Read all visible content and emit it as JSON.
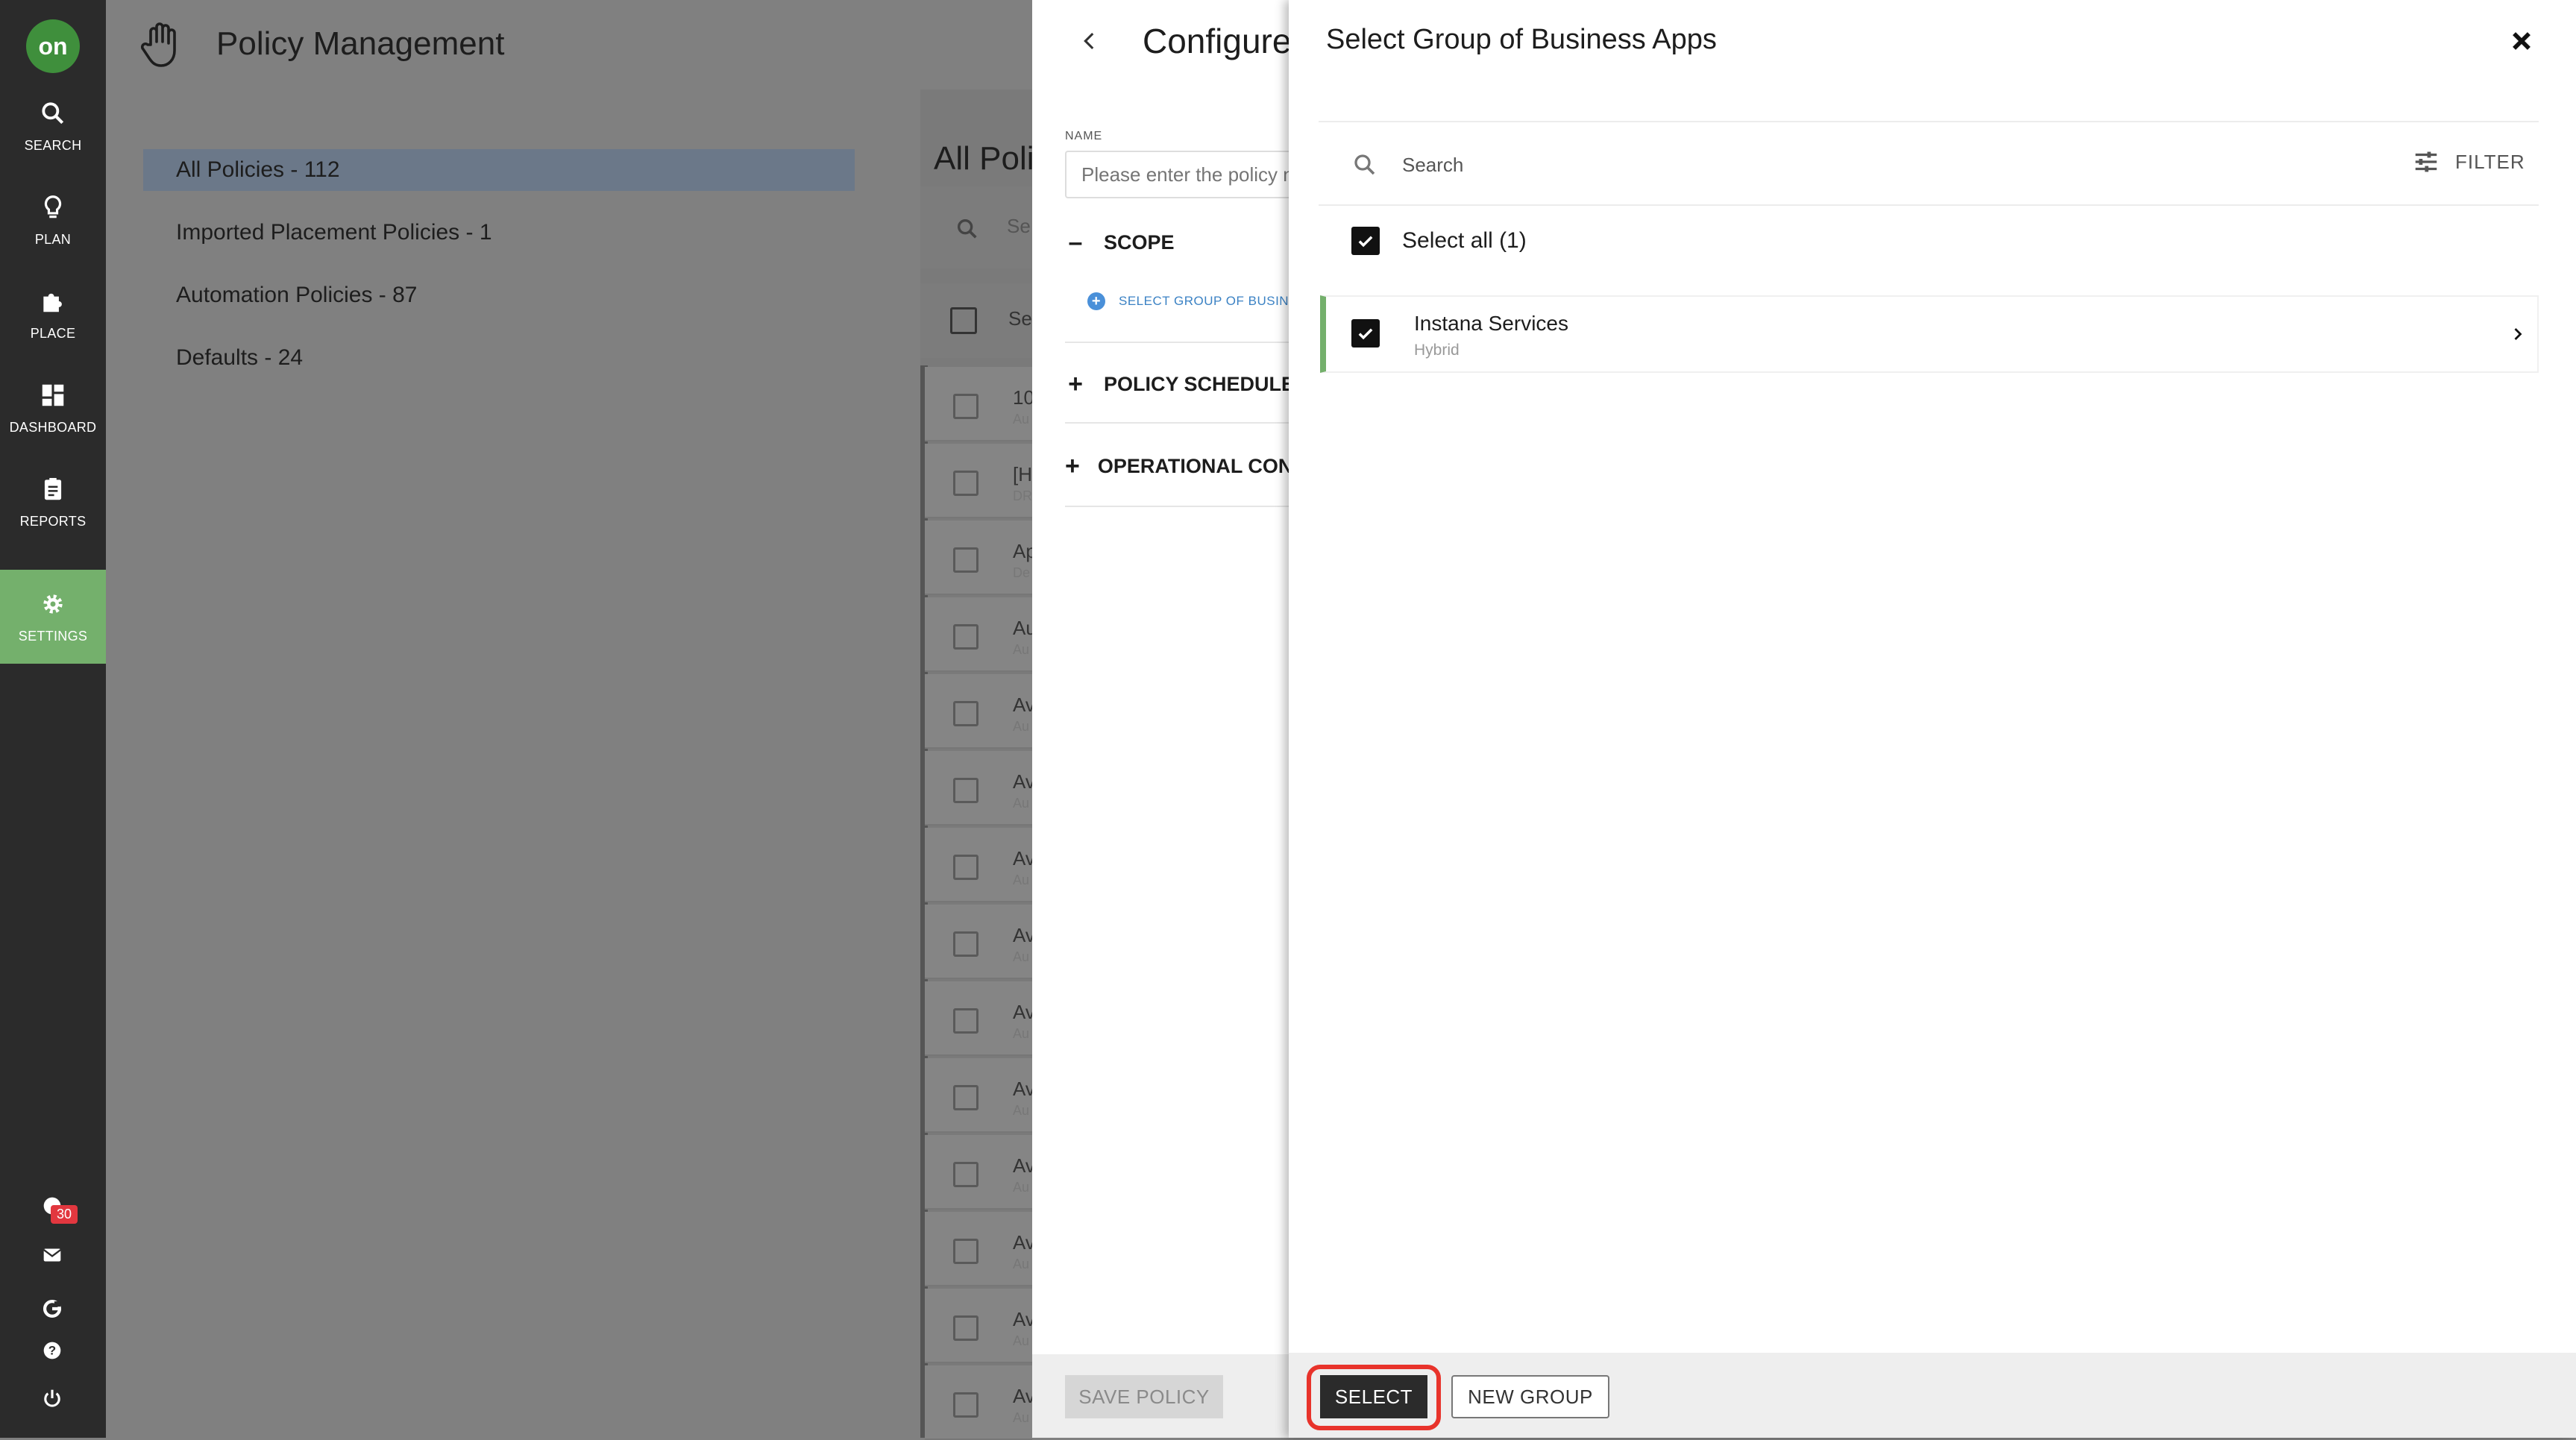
{
  "nav": {
    "logo": "on",
    "items": [
      {
        "label": "SEARCH",
        "icon": "search-icon"
      },
      {
        "label": "PLAN",
        "icon": "lightbulb-icon"
      },
      {
        "label": "PLACE",
        "icon": "puzzle-icon"
      },
      {
        "label": "DASHBOARD",
        "icon": "dashboard-icon"
      },
      {
        "label": "REPORTS",
        "icon": "clipboard-icon"
      },
      {
        "label": "SETTINGS",
        "icon": "gear-icon"
      }
    ],
    "notification_count": "30",
    "active_color": "#74b06c"
  },
  "background": {
    "title": "Policy Management",
    "sidebar": [
      {
        "label": "All Policies - 112"
      },
      {
        "label": "Imported Placement Policies - 1"
      },
      {
        "label": "Automation Policies - 87"
      },
      {
        "label": "Defaults - 24"
      }
    ],
    "list_title": "All Poli",
    "search_fragment": "Se",
    "header_fragment": "Se",
    "rows": [
      {
        "t1": "10",
        "t2": "Au"
      },
      {
        "t1": "[H",
        "t2": "DR"
      },
      {
        "t1": "Ap",
        "t2": "De"
      },
      {
        "t1": "Au",
        "t2": "Au"
      },
      {
        "t1": "Av",
        "t2": "Au"
      },
      {
        "t1": "Av",
        "t2": "Au"
      },
      {
        "t1": "Av",
        "t2": "Au"
      },
      {
        "t1": "Av",
        "t2": "Au"
      },
      {
        "t1": "Av",
        "t2": "Au"
      },
      {
        "t1": "Av",
        "t2": "Au"
      },
      {
        "t1": "Av",
        "t2": "Au"
      },
      {
        "t1": "Av",
        "t2": "Au"
      },
      {
        "t1": "Av",
        "t2": "Au"
      },
      {
        "t1": "Av",
        "t2": "Au"
      }
    ]
  },
  "configure": {
    "title": "Configure",
    "name_label": "NAME",
    "name_placeholder": "Please enter the policy n",
    "scope_label": "SCOPE",
    "scope_link": "SELECT GROUP OF BUSINE",
    "schedule_label": "POLICY SCHEDULE",
    "operational_label": "OPERATIONAL CONS",
    "save_label": "SAVE POLICY"
  },
  "select_panel": {
    "title": "Select Group of Business Apps",
    "search_placeholder": "Search",
    "filter_label": "FILTER",
    "select_all_label": "Select all (1)",
    "items": [
      {
        "name": "Instana Services",
        "type": "Hybrid",
        "checked": true
      }
    ],
    "select_label": "SELECT",
    "new_group_label": "NEW GROUP",
    "highlight_color": "#e8332b"
  }
}
